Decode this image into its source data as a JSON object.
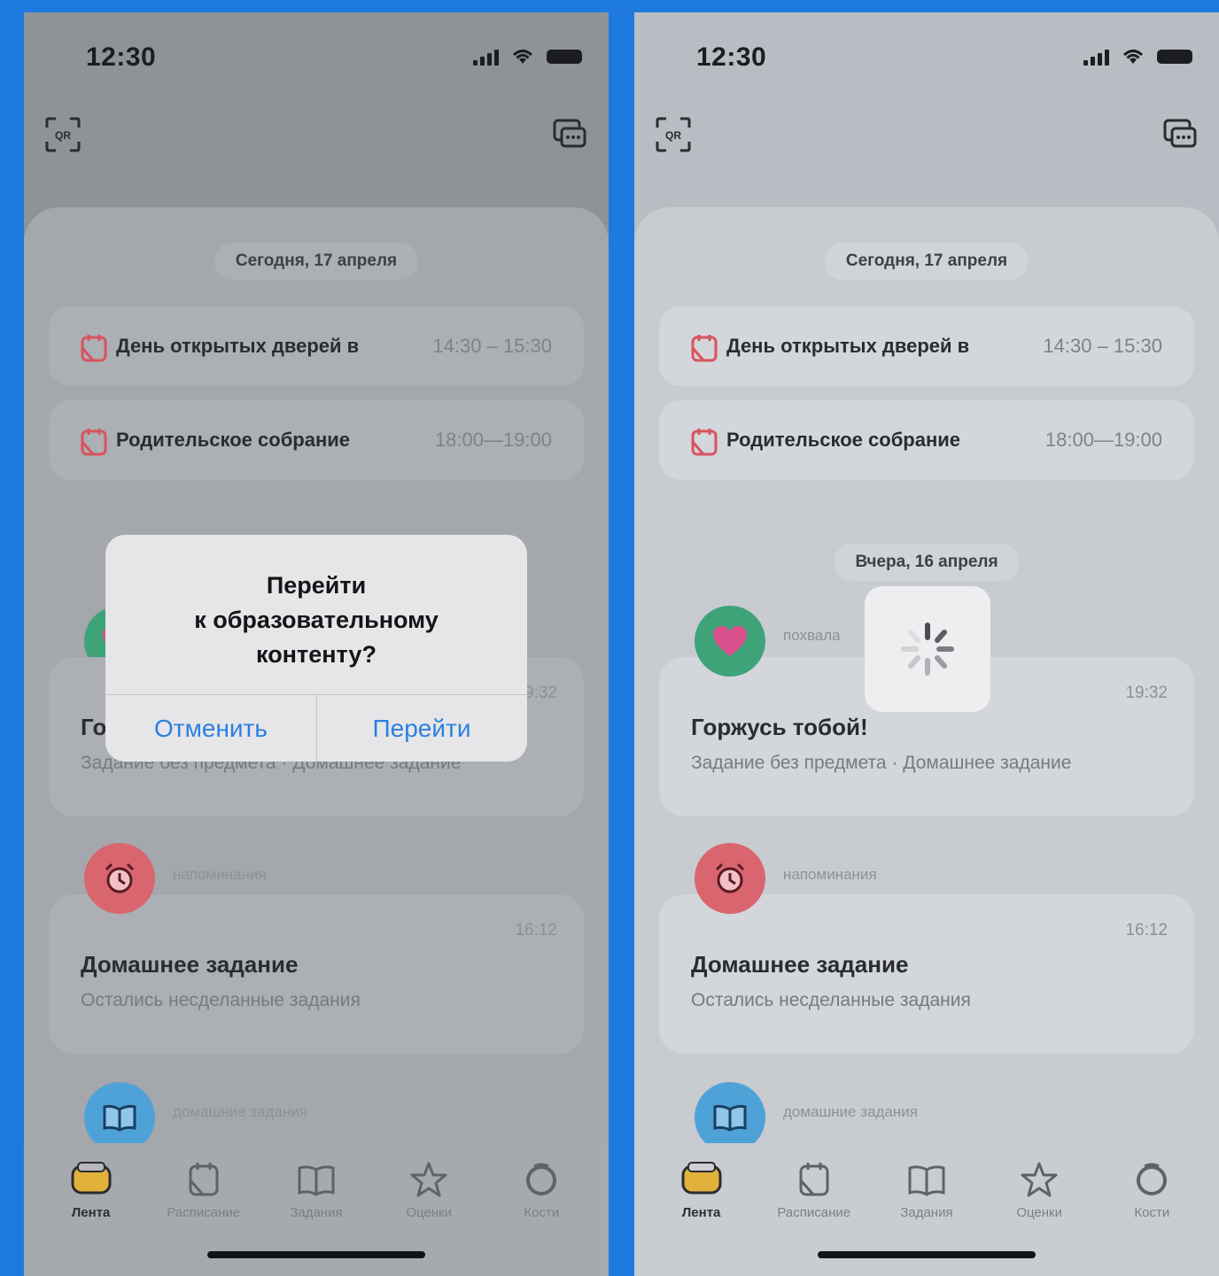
{
  "colors": {
    "background": "#1f7ae0",
    "accent": "#2c7fe0",
    "event_icon": "#d9535f"
  },
  "status_bar": {
    "time": "12:30"
  },
  "header": {
    "qr_icon": "qr-code-icon",
    "chat_icon": "chat-icon"
  },
  "feed": {
    "today_label": "Сегодня, 17 апреля",
    "yesterday_label": "Вчера, 16 апреля",
    "events": [
      {
        "title": "День открытых дверей в",
        "time": "14:30 – 15:30"
      },
      {
        "title": "Родительское собрание",
        "time": "18:00—19:00"
      }
    ],
    "praise": {
      "category": "похвала",
      "time": "19:32",
      "title": "Горжусь тобой!",
      "subtitle": "Задание без предмета · Домашнее задание"
    },
    "reminder": {
      "category": "напоминания",
      "time": "16:12",
      "title": "Домашнее задание",
      "subtitle": "Остались несделанные задания"
    },
    "homework": {
      "category": "домашние задания"
    }
  },
  "dialog": {
    "title_line1": "Перейти",
    "title_line2": "к образовательному",
    "title_line3": "контенту?",
    "cancel_label": "Отменить",
    "confirm_label": "Перейти"
  },
  "tabbar": {
    "items": [
      {
        "label": "Лента",
        "icon": "feed-icon"
      },
      {
        "label": "Расписание",
        "icon": "calendar-icon"
      },
      {
        "label": "Задания",
        "icon": "book-icon"
      },
      {
        "label": "Оценки",
        "icon": "star-icon"
      },
      {
        "label": "Кости",
        "icon": "circle-icon"
      }
    ]
  }
}
